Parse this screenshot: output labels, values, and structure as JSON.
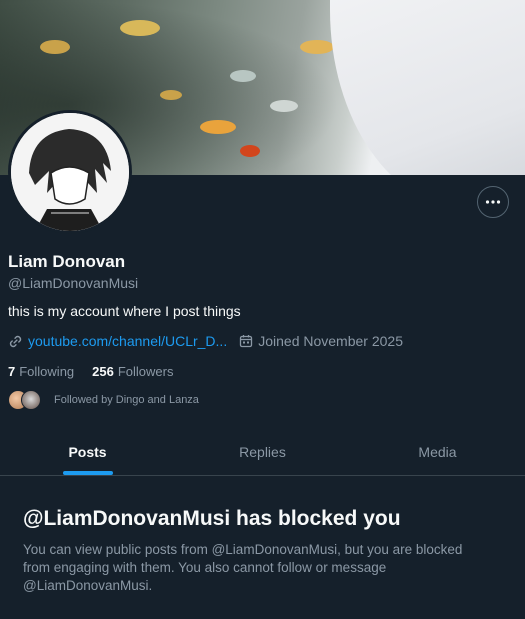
{
  "profile": {
    "name": "Liam Donovan",
    "handle": "@LiamDonovanMusi",
    "bio": "this is my account where I post things",
    "link": "youtube.com/channel/UCLr_D...",
    "joined": "Joined November 2025",
    "following_count": "7",
    "following_label": "Following",
    "followers_count": "256",
    "followers_label": "Followers",
    "followed_by": "Followed by Dingo and Lanza"
  },
  "tabs": [
    {
      "label": "Posts",
      "active": true
    },
    {
      "label": "Replies",
      "active": false
    },
    {
      "label": "Media",
      "active": false
    }
  ],
  "blocked": {
    "title": "@LiamDonovanMusi has blocked you",
    "body": "You can view public posts from @LiamDonovanMusi, but you are blocked from engaging with them. You also cannot follow or message @LiamDonovanMusi."
  },
  "icons": {
    "more": "more-icon",
    "link": "link-icon",
    "calendar": "calendar-icon"
  },
  "colors": {
    "background": "#15202b",
    "accent": "#1d9bf0",
    "secondary_text": "#8b98a5"
  }
}
